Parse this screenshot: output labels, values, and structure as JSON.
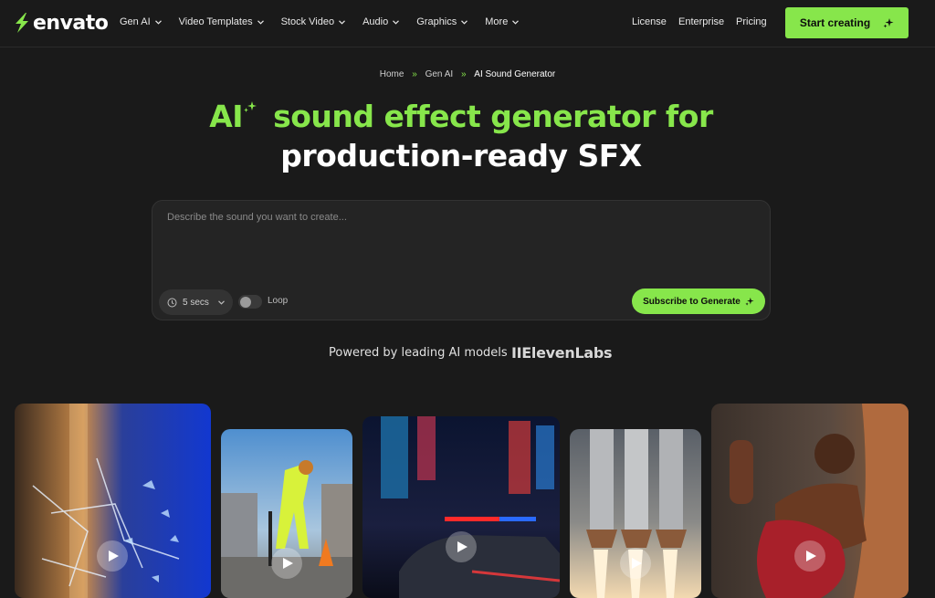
{
  "brand": {
    "name": "envato",
    "accent": "#87e64b"
  },
  "nav": {
    "menu": [
      "Gen AI",
      "Video Templates",
      "Stock Video",
      "Audio",
      "Graphics",
      "More"
    ],
    "links": {
      "license": "License",
      "enterprise": "Enterprise",
      "pricing": "Pricing"
    },
    "cta": "Start creating"
  },
  "breadcrumb": {
    "items": [
      "Home",
      "Gen AI",
      "AI Sound Generator"
    ],
    "separator": "»"
  },
  "hero": {
    "line1": "AI sound effect generator for",
    "line2": "production-ready SFX"
  },
  "prompt": {
    "placeholder": "Describe the sound you want to create...",
    "duration": "5 secs",
    "loop_label": "Loop",
    "loop_enabled": false,
    "generate_label": "Subscribe to Generate"
  },
  "powered": {
    "label": "Powered by leading AI models",
    "partner": "IIElevenLabs"
  },
  "cards": [
    {
      "name": "shattered-glass",
      "icon": "play-icon"
    },
    {
      "name": "construction-worker-jackhammer",
      "icon": "play-icon"
    },
    {
      "name": "police-car-city-night",
      "icon": "play-icon"
    },
    {
      "name": "rocket-launch",
      "icon": "play-icon"
    },
    {
      "name": "boxer-punching-bag",
      "icon": "play-icon"
    }
  ]
}
